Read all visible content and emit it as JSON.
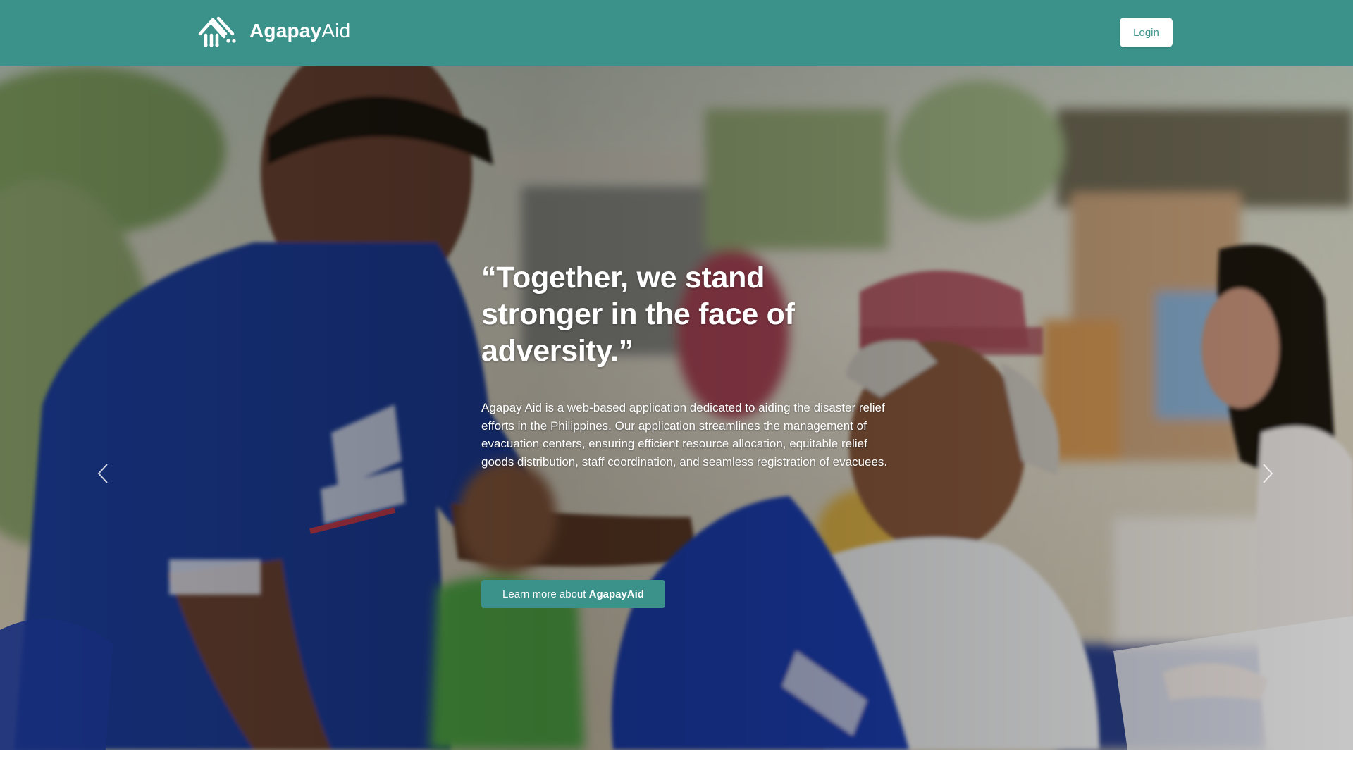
{
  "header": {
    "brand": {
      "name_bold": "Agapay",
      "name_regular": "Aid",
      "logo_icon": "house-hands-icon"
    },
    "login_label": "Login",
    "background_color": "#3a928b"
  },
  "hero": {
    "quote": "“Together, we stand stronger in the face of adversity.”",
    "description": "Agapay Aid is a web-based application dedicated to aiding the disaster relief efforts in the Philippines. Our application streamlines the management of evacuation centers, ensuring efficient resource allocation, equitable relief goods distribution, staff coordination, and seamless registration of evacuees.",
    "cta": {
      "prefix": "Learn more about ",
      "brand": "AgapayAid"
    },
    "carousel": {
      "prev_icon": "chevron-left-icon",
      "next_icon": "chevron-right-icon",
      "slide_count": 3,
      "active_slide": 3
    }
  },
  "colors": {
    "accent": "#3a928b",
    "text_on_accent": "#ffffff"
  }
}
